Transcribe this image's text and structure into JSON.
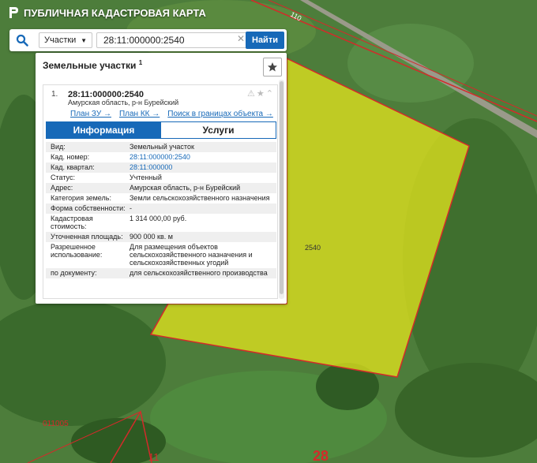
{
  "app": {
    "title": "ПУБЛИЧНАЯ КАДАСТРОВАЯ КАРТА"
  },
  "search": {
    "type_label": "Участки",
    "value": "28:11:000000:2540",
    "button_label": "Найти"
  },
  "panel": {
    "title": "Земельные участки",
    "count": "1"
  },
  "result": {
    "index": "1.",
    "cad_number": "28:11:000000:2540",
    "address": "Амурская область, р-н Бурейский",
    "links": [
      "План ЗУ →",
      "План КК →",
      "Поиск в границах объекта →"
    ],
    "tabs": [
      "Информация",
      "Услуги"
    ],
    "properties": [
      {
        "k": "Вид:",
        "v": "Земельный участок"
      },
      {
        "k": "Кад. номер:",
        "v": "28:11:000000:2540"
      },
      {
        "k": "Кад. квартал:",
        "v": "28:11:000000"
      },
      {
        "k": "Статус:",
        "v": "Учтенный"
      },
      {
        "k": "Адрес:",
        "v": "Амурская область, р-н Бурейский"
      },
      {
        "k": "Категория земель:",
        "v": "Земли сельскохозяйственного назначения"
      },
      {
        "k": "Форма собственности:",
        "v": "-"
      },
      {
        "k": "Кадастровая стоимость:",
        "v": "1 314 000,00 руб."
      },
      {
        "k": "Уточненная площадь:",
        "v": "900 000 кв. м"
      },
      {
        "k": "Разрешенное использование:",
        "v": "Для размещения объектов сельскохозяйственного назначения и сельскохозяйственных угодий"
      },
      {
        "k": "по документу:",
        "v": "для сельскохозяйственного производства"
      }
    ]
  },
  "map": {
    "parcel_label": "2540",
    "labels": {
      "block": "011005",
      "road": "110",
      "num_11": "11",
      "num_28": "28"
    },
    "colors": {
      "parcel_fill": "#e6e61e",
      "boundary": "#d42a2a",
      "accent": "#1769b8"
    }
  }
}
